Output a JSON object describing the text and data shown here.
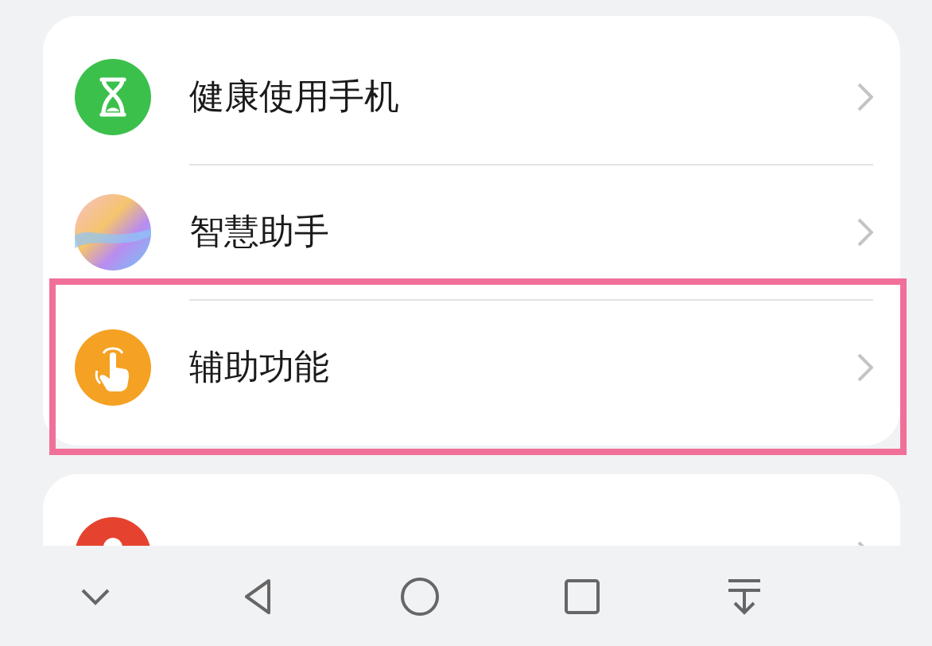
{
  "groups": [
    {
      "items": [
        {
          "label": "健康使用手机",
          "kind": "hourglass",
          "highlighted": false
        },
        {
          "label": "智慧助手",
          "kind": "orb",
          "highlighted": false
        },
        {
          "label": "辅助功能",
          "kind": "hand",
          "highlighted": true
        }
      ]
    },
    {
      "items": [
        {
          "kind": "person",
          "highlighted": false
        }
      ]
    }
  ]
}
